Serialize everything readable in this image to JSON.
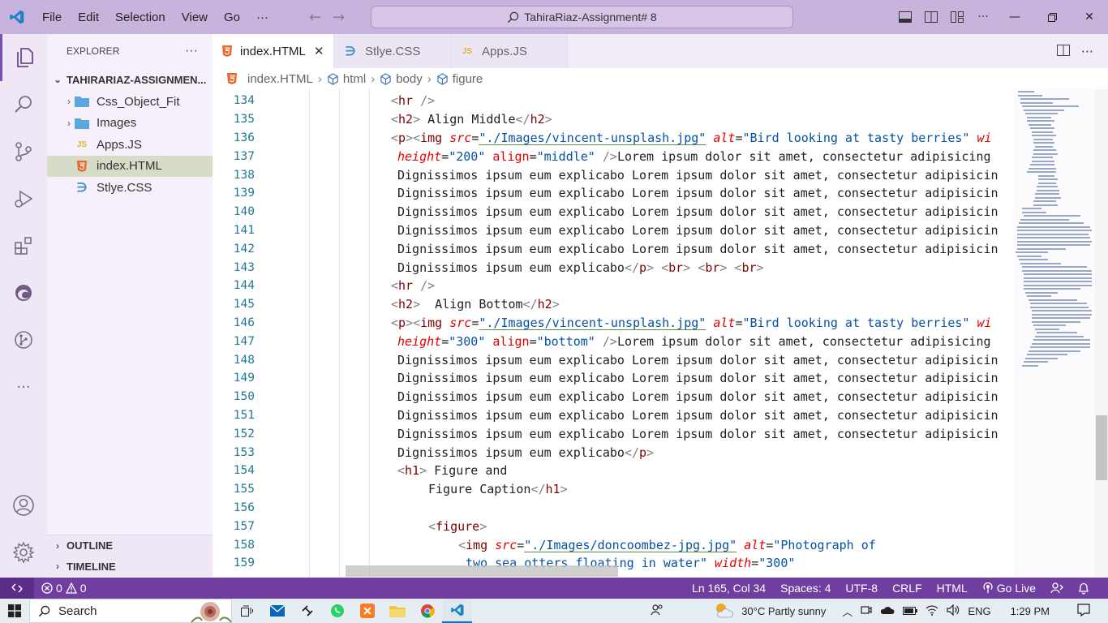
{
  "titlebar": {
    "menu": [
      "File",
      "Edit",
      "Selection",
      "View",
      "Go"
    ],
    "more": "···",
    "search_text": "TahiraRiaz-Assignment# 8"
  },
  "sidebar": {
    "header": "EXPLORER",
    "more": "···",
    "root": "TAHIRARIAZ-ASSIGNMEN...",
    "items": [
      {
        "label": "Css_Object_Fit",
        "type": "folder"
      },
      {
        "label": "Images",
        "type": "folder"
      },
      {
        "label": "Apps.JS",
        "type": "js"
      },
      {
        "label": "index.HTML",
        "type": "html"
      },
      {
        "label": "Stlye.CSS",
        "type": "css"
      }
    ],
    "outline": "OUTLINE",
    "timeline": "TIMELINE"
  },
  "tabs": [
    {
      "label": "index.HTML",
      "type": "html",
      "active": true
    },
    {
      "label": "Stlye.CSS",
      "type": "css",
      "active": false
    },
    {
      "label": "Apps.JS",
      "type": "js",
      "active": false
    }
  ],
  "breadcrumb": [
    "index.HTML",
    "html",
    "body",
    "figure"
  ],
  "editor": {
    "line_numbers": [
      "134",
      "135",
      "136",
      "137",
      "138",
      "139",
      "140",
      "141",
      "142",
      "143",
      "144",
      "145",
      "146",
      "147",
      "148",
      "149",
      "150",
      "151",
      "152",
      "153",
      "154",
      "155",
      "156",
      "157",
      "158",
      "159"
    ],
    "text": {
      "dig": "Dignissimos ipsum eum explicabo Lorem ipsum dolor sit amet, consectetur adipisicin",
      "dig_last": "Dignissimos ipsum eum explicabo",
      "lorem": "Lorem ipsum dolor sit amet, consectetur adipisicing",
      "align_middle": " Align Middle",
      "align_bottom": "  Align Bottom",
      "figure_and": " Figure and",
      "figure_caption": "Figure Caption",
      "img_src1": "\"./Images/vincent-unsplash.jpg\"",
      "img_src2": "\"./Images/doncoombez-jpg.jpg\"",
      "alt_val1": "\"Bird looking at tasty berries\"",
      "alt_val2": "\"Photograph of",
      "otters": "two sea otters floating in water\"",
      "h200": "\"200\"",
      "h300": "\"300\"",
      "w300": "\"300\"",
      "middle": "\"middle\"",
      "bottom": "\"bottom\"",
      "wi": "wi"
    }
  },
  "statusbar": {
    "errors": "0",
    "warnings": "0",
    "position": "Ln 165, Col 34",
    "spaces": "Spaces: 4",
    "encoding": "UTF-8",
    "eol": "CRLF",
    "language": "HTML",
    "golive": "Go Live"
  },
  "taskbar": {
    "search": "Search",
    "weather": "30°C  Partly sunny",
    "lang": "ENG",
    "time": "1:29 PM"
  }
}
